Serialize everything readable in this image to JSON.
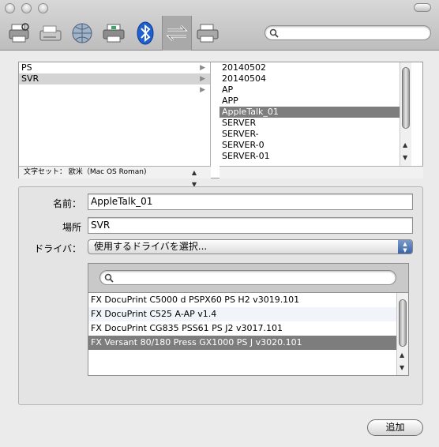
{
  "toolbar": {
    "icons": [
      "default-printer-icon",
      "fax-icon",
      "ip-printer-icon",
      "windows-printer-icon",
      "bluetooth-icon",
      "appletalk-icon",
      "more-printers-icon"
    ],
    "search_placeholder": ""
  },
  "browser": {
    "zones": [
      {
        "label": "PS",
        "has_arrow": true
      },
      {
        "label": "SVR",
        "has_arrow": true,
        "selected": true
      },
      {
        "label": "",
        "has_arrow": true
      }
    ],
    "encoding": "文字セット： 欧米（Mac OS Roman)",
    "printers": [
      "20140502",
      "20140504",
      "AP",
      "APP",
      "AppleTalk_01",
      "SERVER",
      "SERVER-",
      "SERVER-0",
      "SERVER-01"
    ],
    "selected_printer": "AppleTalk_01"
  },
  "form": {
    "name_label": "名前：",
    "name_value": "AppleTalk_01",
    "location_label": "場所",
    "location_value": "SVR",
    "driver_label": "ドライバ：",
    "driver_value": "使用するドライバを選択..."
  },
  "drivers": {
    "search_placeholder": "",
    "items": [
      "FX DocuPrint C5000 d PSPX60 PS H2 v3019.101",
      "FX DocuPrint C525 A-AP v1.4",
      "FX DocuPrint CG835 PSS61 PS J2 v3017.101",
      "FX Versant 80/180 Press GX1000 PS J v3020.101"
    ],
    "selected": "FX Versant 80/180 Press GX1000 PS J v3020.101"
  },
  "buttons": {
    "add_label": "追加"
  }
}
